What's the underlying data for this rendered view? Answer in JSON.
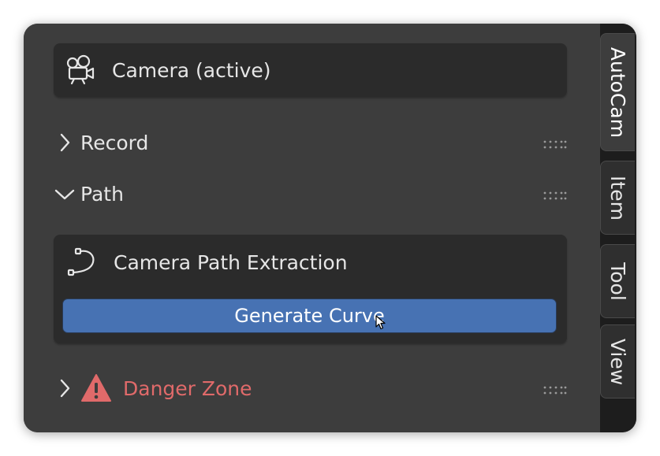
{
  "camera_box": {
    "label": "Camera (active)",
    "icon": "camera-icon"
  },
  "sections": {
    "record": {
      "label": "Record",
      "expanded": false
    },
    "path": {
      "label": "Path",
      "expanded": true
    },
    "danger": {
      "label": "Danger Zone",
      "expanded": false,
      "color": "#e06a6a"
    }
  },
  "path_panel": {
    "title": "Camera Path Extraction",
    "icon": "curve-path-icon",
    "button_label": "Generate Curve",
    "button_color": "#4772b3"
  },
  "tabs": [
    {
      "label": "AutoCam",
      "active": true
    },
    {
      "label": "Item",
      "active": false
    },
    {
      "label": "Tool",
      "active": false
    },
    {
      "label": "View",
      "active": false
    }
  ]
}
